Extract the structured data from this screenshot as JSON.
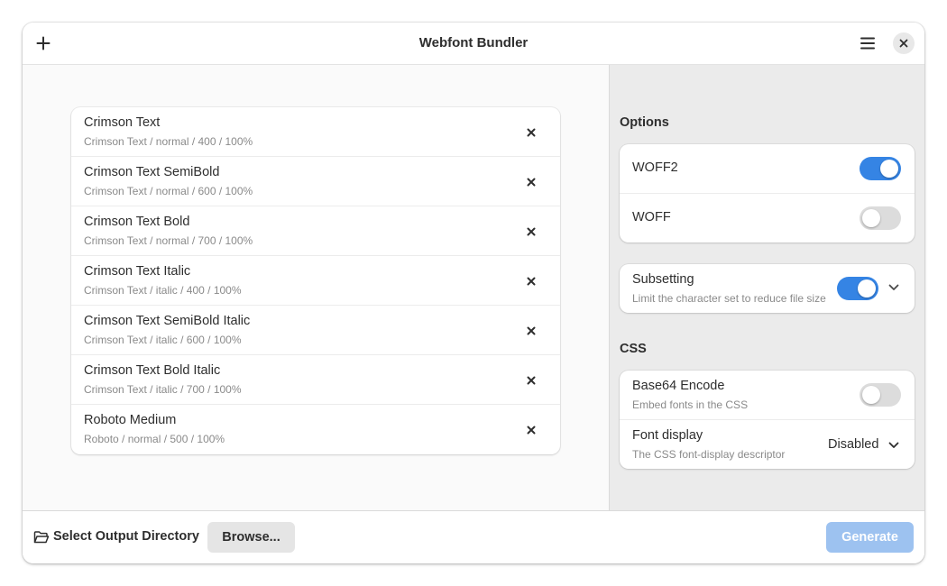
{
  "window": {
    "title": "Webfont Bundler"
  },
  "header": {
    "add_icon": "plus-icon",
    "menu_icon": "hamburger-menu-icon",
    "close_icon": "close-icon"
  },
  "fonts": [
    {
      "name": "Crimson Text",
      "details": "Crimson Text / normal / 400 / 100%"
    },
    {
      "name": "Crimson Text SemiBold",
      "details": "Crimson Text / normal / 600 / 100%"
    },
    {
      "name": "Crimson Text Bold",
      "details": "Crimson Text / normal / 700 / 100%"
    },
    {
      "name": "Crimson Text Italic",
      "details": "Crimson Text / italic / 400 / 100%"
    },
    {
      "name": "Crimson Text SemiBold Italic",
      "details": "Crimson Text / italic / 600 / 100%"
    },
    {
      "name": "Crimson Text Bold Italic",
      "details": "Crimson Text / italic / 700 / 100%"
    },
    {
      "name": "Roboto Medium",
      "details": "Roboto / normal / 500 / 100%"
    }
  ],
  "options": {
    "title": "Options",
    "woff2": {
      "label": "WOFF2",
      "enabled": true
    },
    "woff": {
      "label": "WOFF",
      "enabled": false
    },
    "subsetting": {
      "label": "Subsetting",
      "subtitle": "Limit the character set to reduce file size",
      "enabled": true
    }
  },
  "css": {
    "title": "CSS",
    "base64": {
      "label": "Base64 Encode",
      "subtitle": "Embed fonts in the CSS",
      "enabled": false
    },
    "font_display": {
      "label": "Font display",
      "subtitle": "The CSS font-display descriptor",
      "value": "Disabled"
    }
  },
  "bottom": {
    "output_label": "Select Output Directory",
    "browse_label": "Browse...",
    "generate_label": "Generate"
  },
  "colors": {
    "accent": "#3584e4",
    "accent_disabled": "#9dc2f0"
  }
}
